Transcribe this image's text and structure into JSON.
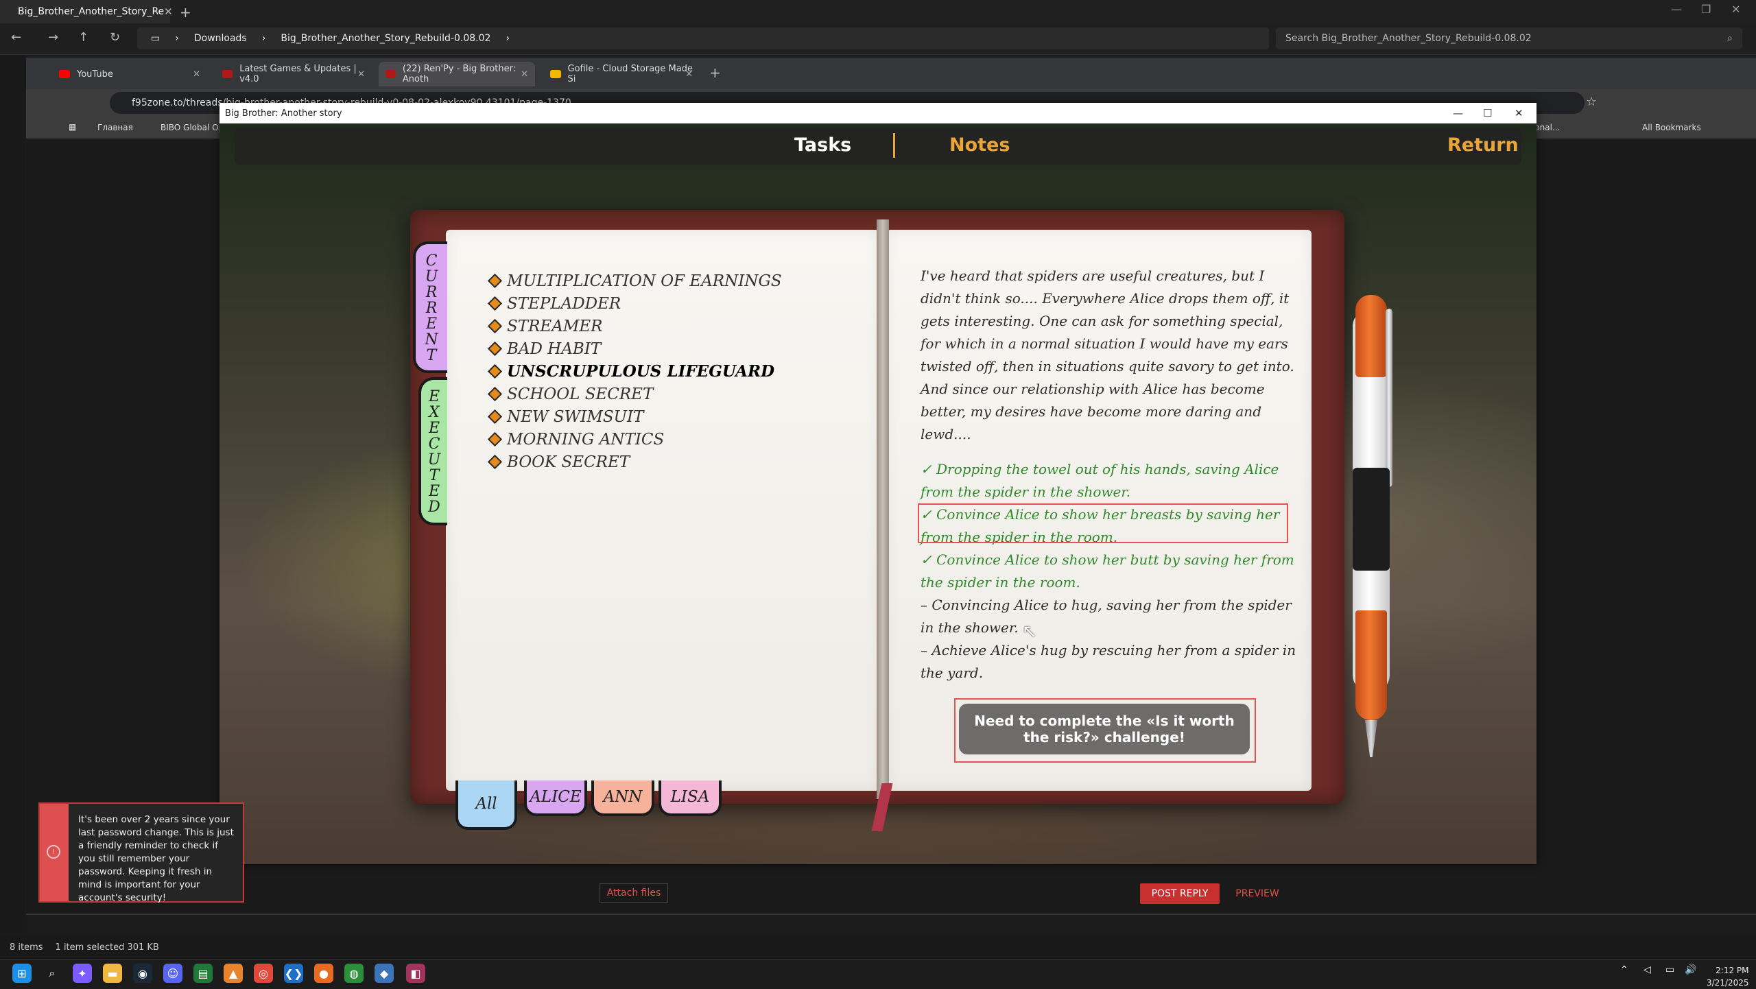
{
  "explorer": {
    "tab_title": "Big_Brother_Another_Story_Re",
    "breadcrumbs": [
      "Downloads",
      "Big_Brother_Another_Story_Rebuild-0.08.02"
    ],
    "search_placeholder": "Search Big_Brother_Another_Story_Rebuild-0.08.02",
    "status_items": "8 items",
    "status_selected": "1 item selected  301 KB"
  },
  "chrome": {
    "tabs": [
      "YouTube",
      "Latest Games & Updates | v4.0",
      "(22) Ren'Py - Big Brother: Anoth",
      "Gofile - Cloud Storage Made Si"
    ],
    "url": "f95zone.to/threads/big-brother-another-story-rebuild-v0-08-02-alexkov90.43101/page-1370",
    "bookmarks": [
      "Главная",
      "BIBO Global Op"
    ],
    "all_bookmarks": "All Bookmarks",
    "bookmark_overflow": "ional...",
    "attach_files": "Attach files",
    "post_reply": "POST REPLY",
    "preview": "PREVIEW"
  },
  "game": {
    "window_title": "Big Brother: Another story",
    "menu": {
      "tasks": "Tasks",
      "notes": "Notes",
      "return": "Return"
    },
    "colors": {
      "menu_active": "#ffffff",
      "menu_accent": "#e9a53a"
    },
    "side_tabs": {
      "current": "CURRENT",
      "executed": "EXECUTED"
    },
    "tasks": [
      "MULTIPLICATION OF EARNINGS",
      "STEPLADDER",
      "STREAMER",
      "BAD HABIT",
      "UNSCRUPULOUS LIFEGUARD",
      "SCHOOL SECRET",
      "NEW SWIMSUIT",
      "MORNING ANTICS",
      "BOOK SECRET"
    ],
    "notes_intro": "I've heard that spiders are useful creatures, but I didn't think so.... Everywhere Alice drops them off, it gets interesting. One can ask for something special, for which in a normal situation I would have my ears twisted off, then in situations quite savory to get into.",
    "notes_intro2": "And since our relationship with Alice has become better, my desires have become more daring and lewd....",
    "done_items": [
      "✓ Dropping the towel out of his hands, saving Alice from the spider in the shower.",
      "✓ Convince Alice to show her breasts by saving her from the spider in the room.",
      "✓ Convince Alice to show her butt by saving her from the spider in the room."
    ],
    "open_items": [
      "– Convincing Alice to hug, saving her from the spider in the shower.",
      "– Achieve Alice's hug by rescuing her from a spider in the yard."
    ],
    "challenge_button": "Need to complete the «Is it worth the risk?» challenge!",
    "char_tabs": [
      "All",
      "ALICE",
      "ANN",
      "LISA"
    ]
  },
  "toast": {
    "message": "It's been over 2 years since your last password change. This is just a friendly reminder to check if you still remember your password. Keeping it fresh in mind is important for your account's security!"
  },
  "taskbar": {
    "time": "2:12 PM",
    "date": "3/21/2025"
  }
}
